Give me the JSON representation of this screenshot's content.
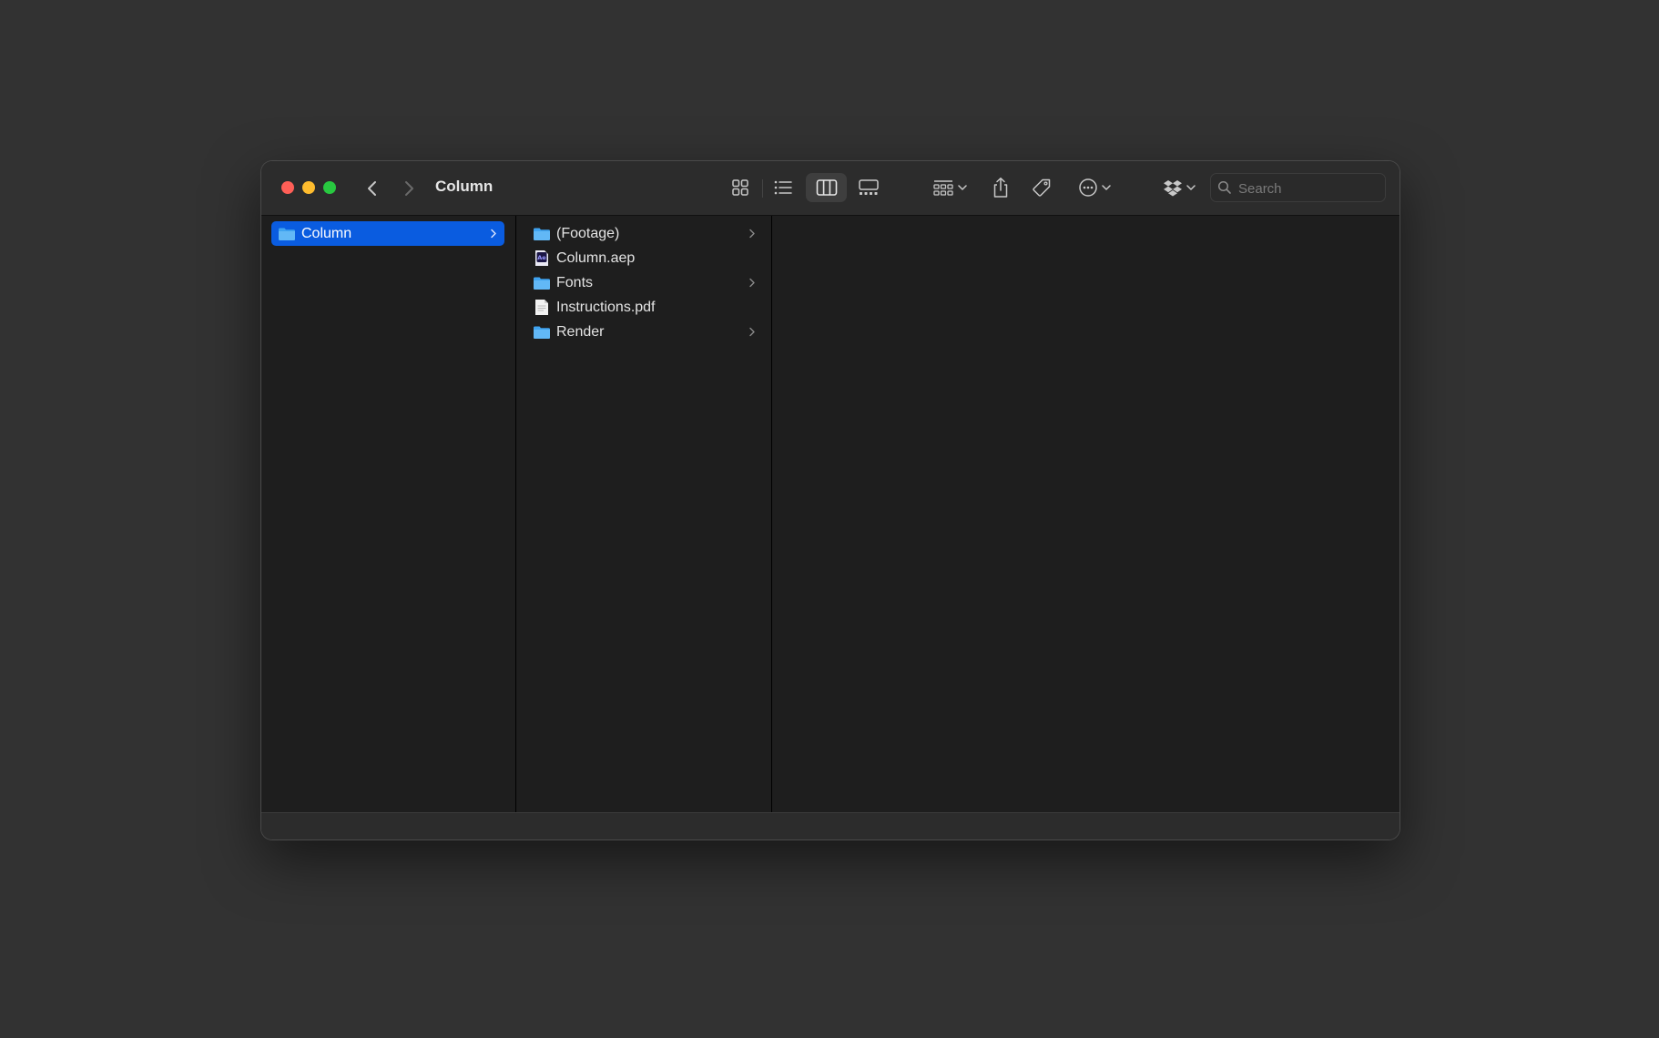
{
  "window": {
    "title": "Column"
  },
  "toolbar": {
    "views": [
      {
        "name": "icon-view",
        "icon": "grid-icon",
        "active": false
      },
      {
        "name": "list-view",
        "icon": "list-icon",
        "active": false
      },
      {
        "name": "column-view",
        "icon": "columns-icon",
        "active": true
      },
      {
        "name": "gallery-view",
        "icon": "gallery-icon",
        "active": false
      }
    ],
    "search": {
      "placeholder": "Search",
      "value": ""
    }
  },
  "columns": {
    "first": {
      "items": [
        {
          "label": "Column",
          "type": "folder",
          "selected": true,
          "has_children": true
        }
      ]
    },
    "second": {
      "items": [
        {
          "label": "(Footage)",
          "type": "folder",
          "has_children": true
        },
        {
          "label": "Column.aep",
          "type": "aep-file",
          "has_children": false
        },
        {
          "label": "Fonts",
          "type": "folder",
          "has_children": true
        },
        {
          "label": "Instructions.pdf",
          "type": "pdf-file",
          "has_children": false
        },
        {
          "label": "Render",
          "type": "folder",
          "has_children": true
        }
      ]
    }
  },
  "colors": {
    "selection": "#0a5ce0",
    "folder": "#3fa3f0",
    "close": "#ff5f57",
    "minimize": "#febc2e",
    "maximize": "#28c840",
    "aep_accent": "#9999ff"
  }
}
